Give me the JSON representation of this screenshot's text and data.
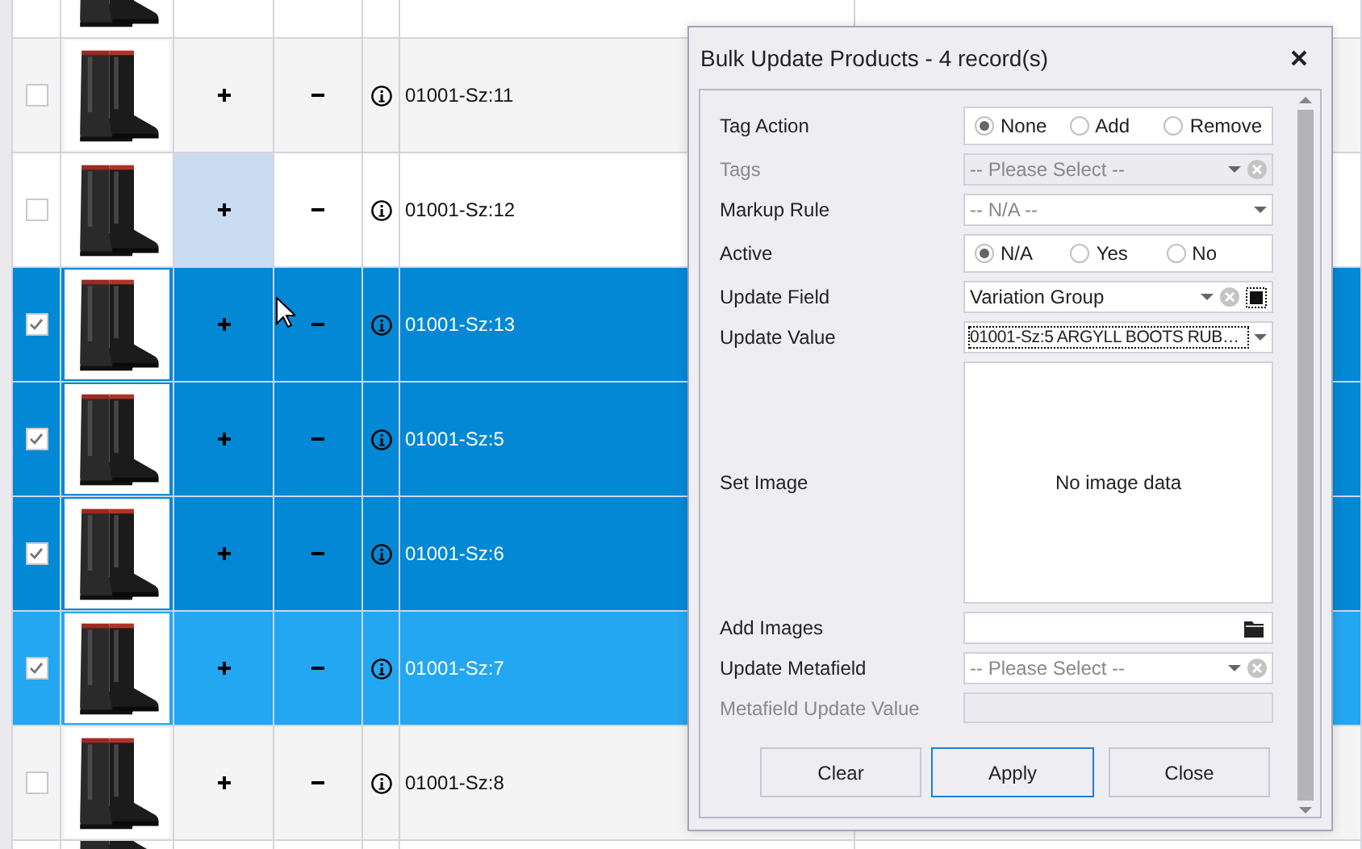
{
  "grid": {
    "rows": [
      {
        "kind": "partial"
      },
      {
        "kind": "full",
        "code": "01001-Sz:11",
        "checked": false,
        "selected": false,
        "focused": false,
        "plus_hovered": false
      },
      {
        "kind": "full",
        "code": "01001-Sz:12",
        "checked": false,
        "selected": false,
        "focused": false,
        "plus_hovered": true
      },
      {
        "kind": "full",
        "code": "01001-Sz:13",
        "checked": true,
        "selected": true,
        "focused": false,
        "plus_hovered": false
      },
      {
        "kind": "full",
        "code": "01001-Sz:5",
        "checked": true,
        "selected": true,
        "focused": false,
        "plus_hovered": false
      },
      {
        "kind": "full",
        "code": "01001-Sz:6",
        "checked": true,
        "selected": true,
        "focused": false,
        "plus_hovered": false
      },
      {
        "kind": "full",
        "code": "01001-Sz:7",
        "checked": true,
        "selected": true,
        "focused": true,
        "plus_hovered": false
      },
      {
        "kind": "full",
        "code": "01001-Sz:8",
        "checked": false,
        "selected": false,
        "focused": false,
        "plus_hovered": false
      },
      {
        "kind": "partial"
      }
    ]
  },
  "dialog": {
    "title": "Bulk Update Products - 4 record(s)",
    "fields": [
      {
        "kind": "radio",
        "label": "Tag Action",
        "disabled": false,
        "options": [
          {
            "label": "None",
            "selected": true
          },
          {
            "label": "Add",
            "selected": false
          },
          {
            "label": "Remove",
            "selected": false
          }
        ]
      },
      {
        "kind": "select",
        "label": "Tags",
        "disabled": true,
        "placeholder": "-- Please Select --",
        "clearable": true,
        "focused": false
      },
      {
        "kind": "select",
        "label": "Markup Rule",
        "disabled": false,
        "placeholder": "-- N/A --",
        "clearable": false,
        "focused": false
      },
      {
        "kind": "radio",
        "label": "Active",
        "disabled": false,
        "options": [
          {
            "label": "N/A",
            "selected": true
          },
          {
            "label": "Yes",
            "selected": false
          },
          {
            "label": "No",
            "selected": false
          }
        ]
      },
      {
        "kind": "select",
        "label": "Update Field",
        "disabled": false,
        "value": "Variation Group",
        "clearable": true,
        "extra_button": true,
        "focused": false
      },
      {
        "kind": "select",
        "label": "Update Value",
        "disabled": false,
        "value": "01001-Sz:5 ARGYLL BOOTS RUB…",
        "clearable": false,
        "focused": true
      },
      {
        "label": "Set Image",
        "disabled": false,
        "empty_text": "No image data"
      },
      {
        "kind": "file",
        "label": "Add Images",
        "disabled": false
      },
      {
        "kind": "select",
        "label": "Update Metafield",
        "disabled": false,
        "placeholder": "-- Please Select --",
        "clearable": true,
        "focused": false
      },
      {
        "kind": "text",
        "label": "Metafield Update Value",
        "disabled": true
      }
    ],
    "buttons": [
      {
        "label": "Clear",
        "default": false
      },
      {
        "label": "Apply",
        "default": true
      },
      {
        "label": "Close",
        "default": false
      }
    ]
  }
}
